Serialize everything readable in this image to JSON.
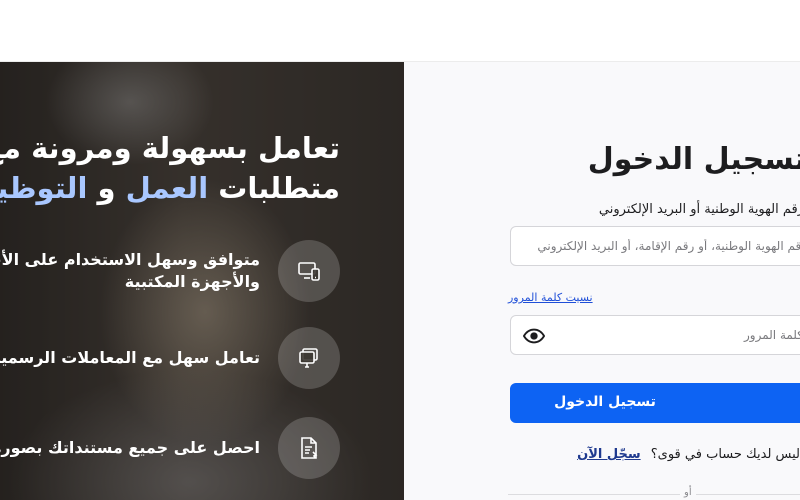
{
  "hero": {
    "title_line1": "تعامل بسهولة ومرونة مع",
    "title_line2_part1": "متطلبات ",
    "title_line2_accent": "العمل",
    "title_line2_part2": " و ",
    "title_line2_accent2": "التوظيف",
    "features": [
      {
        "icon": "devices-icon",
        "line1": "متوافق وسهل الاستخدام على الأجهزة الذكية",
        "line2": "والأجهزة المكتبية"
      },
      {
        "icon": "monitor-icon",
        "line1": "تعامل سهل مع المعاملات الرسمية",
        "line2": ""
      },
      {
        "icon": "document-icon",
        "line1": "احصل على جميع مستنداتك بصورة رقمية",
        "line2": ""
      }
    ]
  },
  "login": {
    "title": "تسجيل الدخول",
    "id_label": "رقم الهوية الوطنية أو البريد الإلكتروني",
    "id_placeholder": "رقم الهوية الوطنية، أو رقم الإقامة، أو البريد الإلكتروني",
    "forgot_password": "نسيت كلمة المرور",
    "password_placeholder": "كلمة المرور",
    "submit": "تسجيل الدخول",
    "no_account": "ليس لديك حساب في قوى؟",
    "register_link": "سجّل الآن",
    "or": "أو"
  },
  "colors": {
    "accent": "#0d63f3",
    "link": "#1f4fd8",
    "hero_accent": "#a9c7ff"
  }
}
